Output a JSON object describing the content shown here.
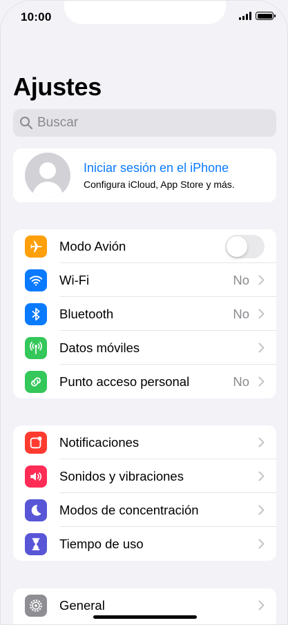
{
  "status_bar": {
    "time": "10:00"
  },
  "header": {
    "title": "Ajustes"
  },
  "search": {
    "placeholder": "Buscar",
    "icon": "search-icon"
  },
  "profile": {
    "title": "Iniciar sesión en el iPhone",
    "subtitle": "Configura iCloud, App Store y más."
  },
  "colors": {
    "accent": "#0a7aff",
    "airplane": "#ff9f0a",
    "wifi": "#0a7aff",
    "bluetooth": "#0a7aff",
    "cellular": "#34c759",
    "hotspot": "#34c759",
    "notifications": "#ff3b30",
    "sounds": "#ff2d55",
    "focus": "#5856d6",
    "screentime": "#5856d6",
    "general": "#8e8e93"
  },
  "group1": [
    {
      "label": "Modo Avión",
      "icon": "airplane-icon",
      "toggle": false
    },
    {
      "label": "Wi-Fi",
      "icon": "wifi-icon",
      "value": "No"
    },
    {
      "label": "Bluetooth",
      "icon": "bluetooth-icon",
      "value": "No"
    },
    {
      "label": "Datos móviles",
      "icon": "cellular-antenna-icon",
      "value": ""
    },
    {
      "label": "Punto acceso personal",
      "icon": "hotspot-icon",
      "value": "No"
    }
  ],
  "group2": [
    {
      "label": "Notificaciones",
      "icon": "bell-icon"
    },
    {
      "label": "Sonidos y vibraciones",
      "icon": "speaker-icon"
    },
    {
      "label": "Modos de concentración",
      "icon": "moon-icon"
    },
    {
      "label": "Tiempo de uso",
      "icon": "hourglass-icon"
    }
  ],
  "group3": [
    {
      "label": "General",
      "icon": "gear-icon"
    }
  ]
}
